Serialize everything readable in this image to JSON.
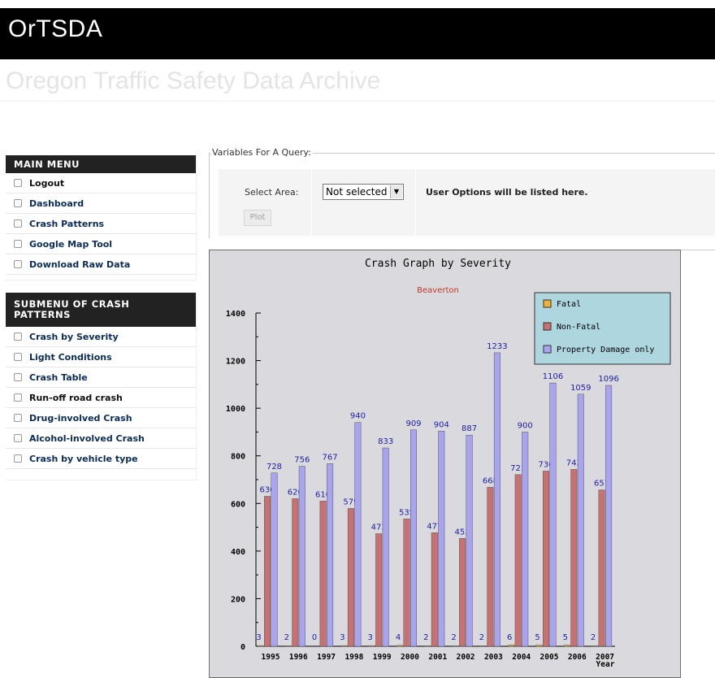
{
  "header": {
    "title": "OrTSDA",
    "subtitle": "Oregon Traffic Safety Data Archive"
  },
  "main_menu": {
    "title": "MAIN MENU",
    "items": [
      {
        "label": "Logout"
      },
      {
        "label": "Dashboard"
      },
      {
        "label": "Crash Patterns"
      },
      {
        "label": "Google Map Tool"
      },
      {
        "label": "Download Raw Data"
      }
    ]
  },
  "sub_menu": {
    "title_line1": "SUBMENU OF CRASH",
    "title_line2": "PATTERNS",
    "items": [
      {
        "label": "Crash by Severity"
      },
      {
        "label": "Light Conditions"
      },
      {
        "label": "Crash Table"
      },
      {
        "label": "Run-off road crash"
      },
      {
        "label": "Drug-involved Crash"
      },
      {
        "label": "Alcohol-involved Crash"
      },
      {
        "label": "Crash by vehicle type"
      }
    ]
  },
  "query": {
    "legend": "Variables For A Query:",
    "select_area_label": "Select Area:",
    "select_value": "Not selected",
    "user_options_text": "User Options will be listed here.",
    "plot_label": "Plot"
  },
  "colors": {
    "fatal": "#f2b233",
    "non_fatal": "#c87171",
    "property_damage": "#a9a4ef",
    "chart_background": "#dad9dd",
    "legend_background": "#aed6df",
    "value_label": "#1d1da8",
    "subtitle": "#c0392b"
  },
  "chart_data": {
    "type": "bar",
    "title": "Crash Graph by Severity",
    "subtitle": "Beaverton",
    "xlabel": "Year",
    "ylabel": "",
    "ylim": [
      0,
      1400
    ],
    "yticks": [
      0,
      200,
      400,
      600,
      800,
      1000,
      1200,
      1400
    ],
    "legend_position": "top-right",
    "categories": [
      "1995",
      "1996",
      "1997",
      "1998",
      "1999",
      "2000",
      "2001",
      "2002",
      "2003",
      "2004",
      "2005",
      "2006",
      "2007"
    ],
    "series": [
      {
        "name": "Fatal",
        "values": [
          3,
          2,
          0,
          3,
          3,
          4,
          2,
          2,
          2,
          6,
          5,
          5,
          2
        ]
      },
      {
        "name": "Non-Fatal",
        "values": [
          630,
          620,
          610,
          579,
          473,
          535,
          477,
          453,
          668,
          721,
          736,
          743,
          657
        ]
      },
      {
        "name": "Property Damage only",
        "values": [
          728,
          756,
          767,
          940,
          833,
          909,
          904,
          887,
          1233,
          900,
          1106,
          1059,
          1096
        ]
      }
    ]
  }
}
